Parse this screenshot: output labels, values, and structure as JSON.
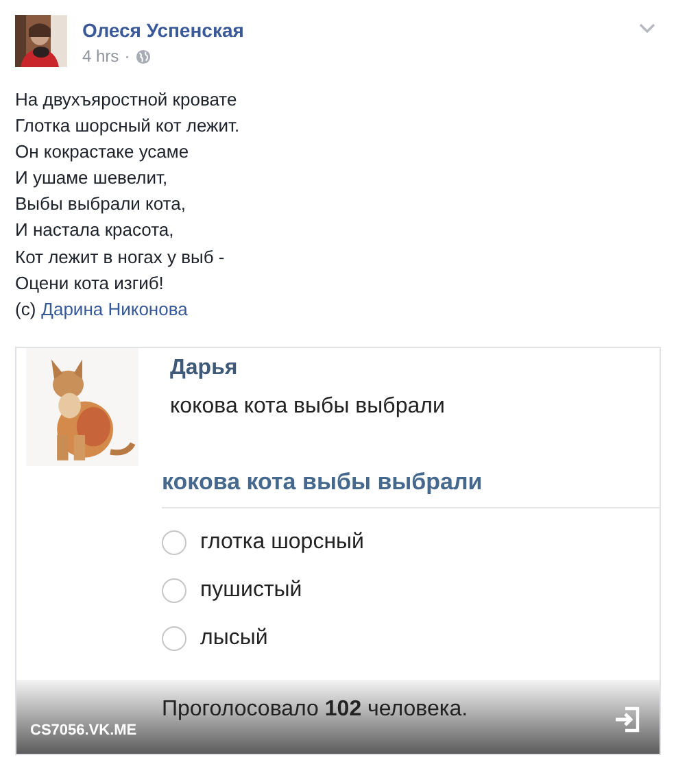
{
  "post": {
    "author": "Олеся Успенская",
    "time": "4 hrs",
    "separator": "·"
  },
  "text_lines": [
    "На двухъяростной кровате",
    "Глотка шорсный кот лежит.",
    "Он кокрастаке усаме",
    "И ушаме шевелит,",
    "Выбы выбрали кота,",
    "И настала красота,",
    "Кот лежит в ногах у выб -",
    "Оцени кота изгиб!"
  ],
  "credit": {
    "prefix": "(c)",
    "author": "Дарина Никонова"
  },
  "embed": {
    "author": "Дарья",
    "message": "кокова кота выбы выбрали",
    "poll": {
      "question": "кокова кота выбы выбрали",
      "options": [
        {
          "label": "глотка шорсный",
          "selected": false
        },
        {
          "label": "пушистый",
          "selected": false
        },
        {
          "label": "лысый",
          "selected": false
        }
      ],
      "votes": "Проголосовало **102** человека."
    },
    "source": "CS7056.VK.ME"
  }
}
